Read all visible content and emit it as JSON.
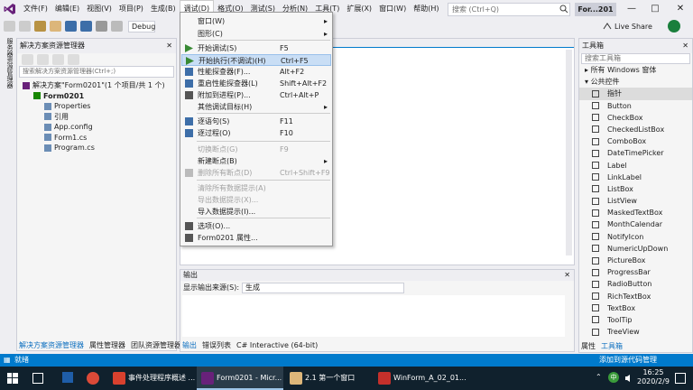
{
  "menubar": {
    "items": [
      "文件(F)",
      "编辑(E)",
      "视图(V)",
      "项目(P)",
      "生成(B)",
      "调试(D)",
      "格式(O)",
      "测试(S)",
      "分析(N)",
      "工具(T)",
      "扩展(X)",
      "窗口(W)",
      "帮助(H)"
    ],
    "search_placeholder": "搜索 (Ctrl+Q)",
    "title_badge": "For...201",
    "live_share": "Live Share"
  },
  "toolbar": {
    "config": "Debug"
  },
  "solution_explorer": {
    "title": "解决方案资源管理器",
    "search_placeholder": "搜索解决方案资源管理器(Ctrl+;)",
    "tree": [
      {
        "label": "解决方案\"Form0201\"(1 个项目/共 1 个)",
        "indent": 0
      },
      {
        "label": "Form0201",
        "indent": 1
      },
      {
        "label": "Properties",
        "indent": 2
      },
      {
        "label": "引用",
        "indent": 2
      },
      {
        "label": "App.config",
        "indent": 2
      },
      {
        "label": "Form1.cs",
        "indent": 2
      },
      {
        "label": "Program.cs",
        "indent": 2
      }
    ],
    "tabs": [
      "解决方案资源管理器",
      "属性管理器",
      "团队资源管理器"
    ]
  },
  "side_strip": "服务器资源管理器",
  "debug_menu": {
    "items": [
      {
        "label": "窗口(W)",
        "shortcut": "",
        "arrow": true,
        "disabled": false,
        "icon": ""
      },
      {
        "label": "图形(C)",
        "shortcut": "",
        "arrow": true,
        "disabled": false,
        "icon": ""
      },
      {
        "label": "开始调试(S)",
        "shortcut": "F5",
        "arrow": false,
        "disabled": false,
        "icon": "play-icon"
      },
      {
        "label": "开始执行(不调试)(H)",
        "shortcut": "Ctrl+F5",
        "arrow": false,
        "disabled": false,
        "icon": "play-outline-icon",
        "highlighted": true
      },
      {
        "label": "性能探查器(F)...",
        "shortcut": "Alt+F2",
        "arrow": false,
        "disabled": false,
        "icon": "profiler-icon"
      },
      {
        "label": "重启性能探查器(L)",
        "shortcut": "Shift+Alt+F2",
        "arrow": false,
        "disabled": false,
        "icon": "profiler-restart-icon"
      },
      {
        "label": "附加到进程(P)...",
        "shortcut": "Ctrl+Alt+P",
        "arrow": false,
        "disabled": false,
        "icon": "attach-icon"
      },
      {
        "label": "其他调试目标(H)",
        "shortcut": "",
        "arrow": true,
        "disabled": false,
        "icon": ""
      },
      {
        "label": "逐语句(S)",
        "shortcut": "F11",
        "arrow": false,
        "disabled": false,
        "icon": "step-into-icon"
      },
      {
        "label": "逐过程(O)",
        "shortcut": "F10",
        "arrow": false,
        "disabled": false,
        "icon": "step-over-icon"
      },
      {
        "label": "切换断点(G)",
        "shortcut": "F9",
        "arrow": false,
        "disabled": true,
        "icon": ""
      },
      {
        "label": "新建断点(B)",
        "shortcut": "",
        "arrow": true,
        "disabled": false,
        "icon": ""
      },
      {
        "label": "删除所有断点(D)",
        "shortcut": "Ctrl+Shift+F9",
        "arrow": false,
        "disabled": true,
        "icon": "delete-breakpoints-icon"
      },
      {
        "label": "清除所有数据提示(A)",
        "shortcut": "",
        "arrow": false,
        "disabled": true,
        "icon": ""
      },
      {
        "label": "导出数据提示(X)...",
        "shortcut": "",
        "arrow": false,
        "disabled": true,
        "icon": ""
      },
      {
        "label": "导入数据提示(I)...",
        "shortcut": "",
        "arrow": false,
        "disabled": false,
        "icon": ""
      },
      {
        "label": "选项(O)...",
        "shortcut": "",
        "arrow": false,
        "disabled": false,
        "icon": "gear-icon"
      },
      {
        "label": "Form0201 属性...",
        "shortcut": "",
        "arrow": false,
        "disabled": false,
        "icon": "wrench-icon"
      }
    ]
  },
  "output": {
    "title": "输出",
    "source_label": "显示输出来源(S):",
    "source_value": "生成",
    "tabs": [
      "输出",
      "错误列表",
      "C# Interactive (64-bit)"
    ]
  },
  "toolbox": {
    "title": "工具箱",
    "search_placeholder": "搜索工具箱",
    "groups": [
      "所有 Windows 窗体",
      "公共控件"
    ],
    "items": [
      "指针",
      "Button",
      "CheckBox",
      "CheckedListBox",
      "ComboBox",
      "DateTimePicker",
      "Label",
      "LinkLabel",
      "ListBox",
      "ListView",
      "MaskedTextBox",
      "MonthCalendar",
      "NotifyIcon",
      "NumericUpDown",
      "PictureBox",
      "ProgressBar",
      "RadioButton",
      "RichTextBox",
      "TextBox",
      "ToolTip",
      "TreeView"
    ],
    "tabs": [
      "属性",
      "工具箱"
    ]
  },
  "status": {
    "ready": "就绪",
    "source_control": "添加到源代码管理"
  },
  "taskbar": {
    "tasks": [
      "事件处理程序概述 ...",
      "Form0201 - Micr...",
      "2.1 第一个窗口",
      "WinForm_A_02_01..."
    ],
    "time": "16:25",
    "date": "2020/2/9",
    "ime": "中"
  },
  "colors": {
    "accent": "#007acc",
    "highlight": "#c9def5",
    "taskbar": "#10212d"
  }
}
